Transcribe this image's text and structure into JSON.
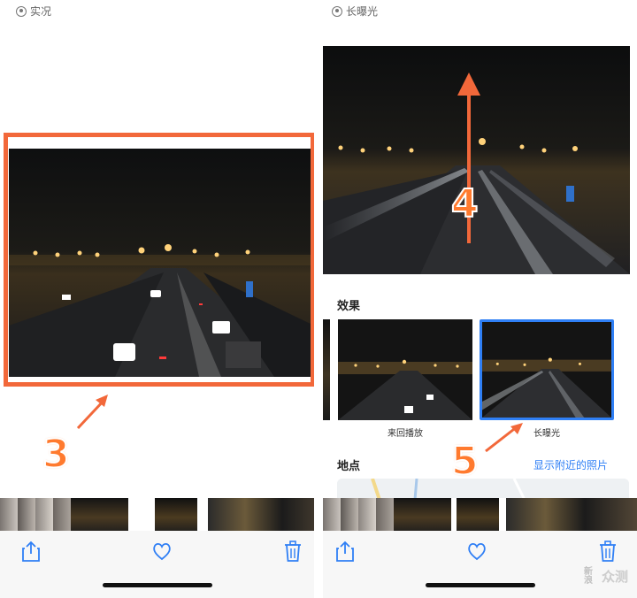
{
  "left": {
    "mode_label": "实况",
    "callout": "3"
  },
  "right": {
    "mode_label": "长曝光",
    "callout_arrow": "4",
    "callout_effect": "5",
    "effects_title": "效果",
    "effects": [
      {
        "label": "来回播放"
      },
      {
        "label": "长曝光",
        "selected": true
      }
    ],
    "location_title": "地点",
    "show_nearby": "显示附近的照片"
  },
  "toolbar": {
    "share_icon": "share-icon",
    "favorite_icon": "heart-icon",
    "delete_icon": "trash-icon"
  },
  "watermark": {
    "line1": "新",
    "line2": "浪",
    "text": "众测"
  },
  "colors": {
    "highlight": "#f2683a",
    "selected_border": "#2f7ff5",
    "link": "#2f7ff5",
    "toolbar_icon": "#2f7ff5"
  }
}
